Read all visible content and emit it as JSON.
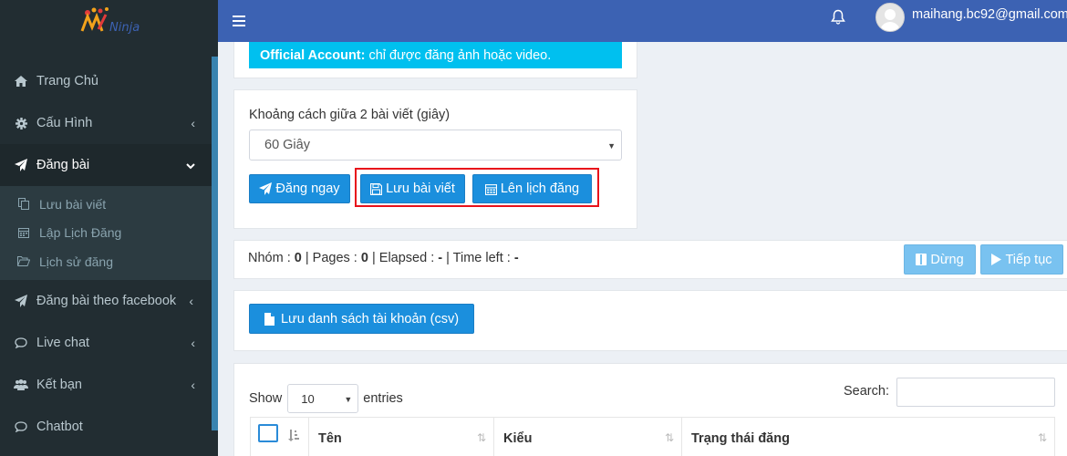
{
  "sidebar": {
    "logo_text": "Ninja",
    "items": [
      {
        "label": "Trang Chủ",
        "icon": "home-icon"
      },
      {
        "label": "Cấu Hình",
        "icon": "gear-icon",
        "arrow": "‹"
      },
      {
        "label": "Đăng bài",
        "icon": "paper-plane-icon",
        "arrow": "⌄"
      },
      {
        "label": "Đăng bài theo facebook",
        "icon": "paper-plane-icon",
        "arrow": "‹"
      },
      {
        "label": "Live chat",
        "icon": "chat-bubble-icon",
        "arrow": "‹"
      },
      {
        "label": "Kết bạn",
        "icon": "users-icon",
        "arrow": "‹"
      },
      {
        "label": "Chatbot",
        "icon": "chat-bubble-icon"
      }
    ],
    "subitems": [
      {
        "label": "Lưu bài viết",
        "icon": "copy-icon"
      },
      {
        "label": "Lập Lịch Đăng",
        "icon": "calendar-icon"
      },
      {
        "label": "Lịch sử đăng",
        "icon": "folder-open-icon"
      }
    ]
  },
  "header": {
    "email": "maihang.bc92@gmail.com"
  },
  "alert": {
    "bold": "Official Account:",
    "text": "chỉ được đăng ảnh hoặc video."
  },
  "form": {
    "label": "Khoảng cách giữa 2 bài viết (giây)",
    "interval_value": "60 Giây",
    "buttons": {
      "post": "Đăng ngay",
      "save": "Lưu bài viết",
      "schedule": "Lên lịch đăng"
    }
  },
  "stats": {
    "text_parts": [
      "Nhóm : ",
      "0",
      " | Pages : ",
      "0",
      " | Elapsed : ",
      "-",
      " | Time left : ",
      "-"
    ],
    "stop_label": "Dừng",
    "continue_label": "Tiếp tục"
  },
  "csv": {
    "button_label": "Lưu danh sách tài khoản (csv)"
  },
  "table": {
    "show_label": "Show",
    "entries_value": "10",
    "entries_label": "entries",
    "search_label": "Search:",
    "columns": [
      "Tên",
      "Kiểu",
      "Trạng thái đăng"
    ]
  },
  "colors": {
    "sidebar_bg": "#222d32",
    "header_bg": "#3c62b3",
    "accent": "#1b8fdd",
    "info": "#00c0ef",
    "highlight": "#e8121b"
  }
}
